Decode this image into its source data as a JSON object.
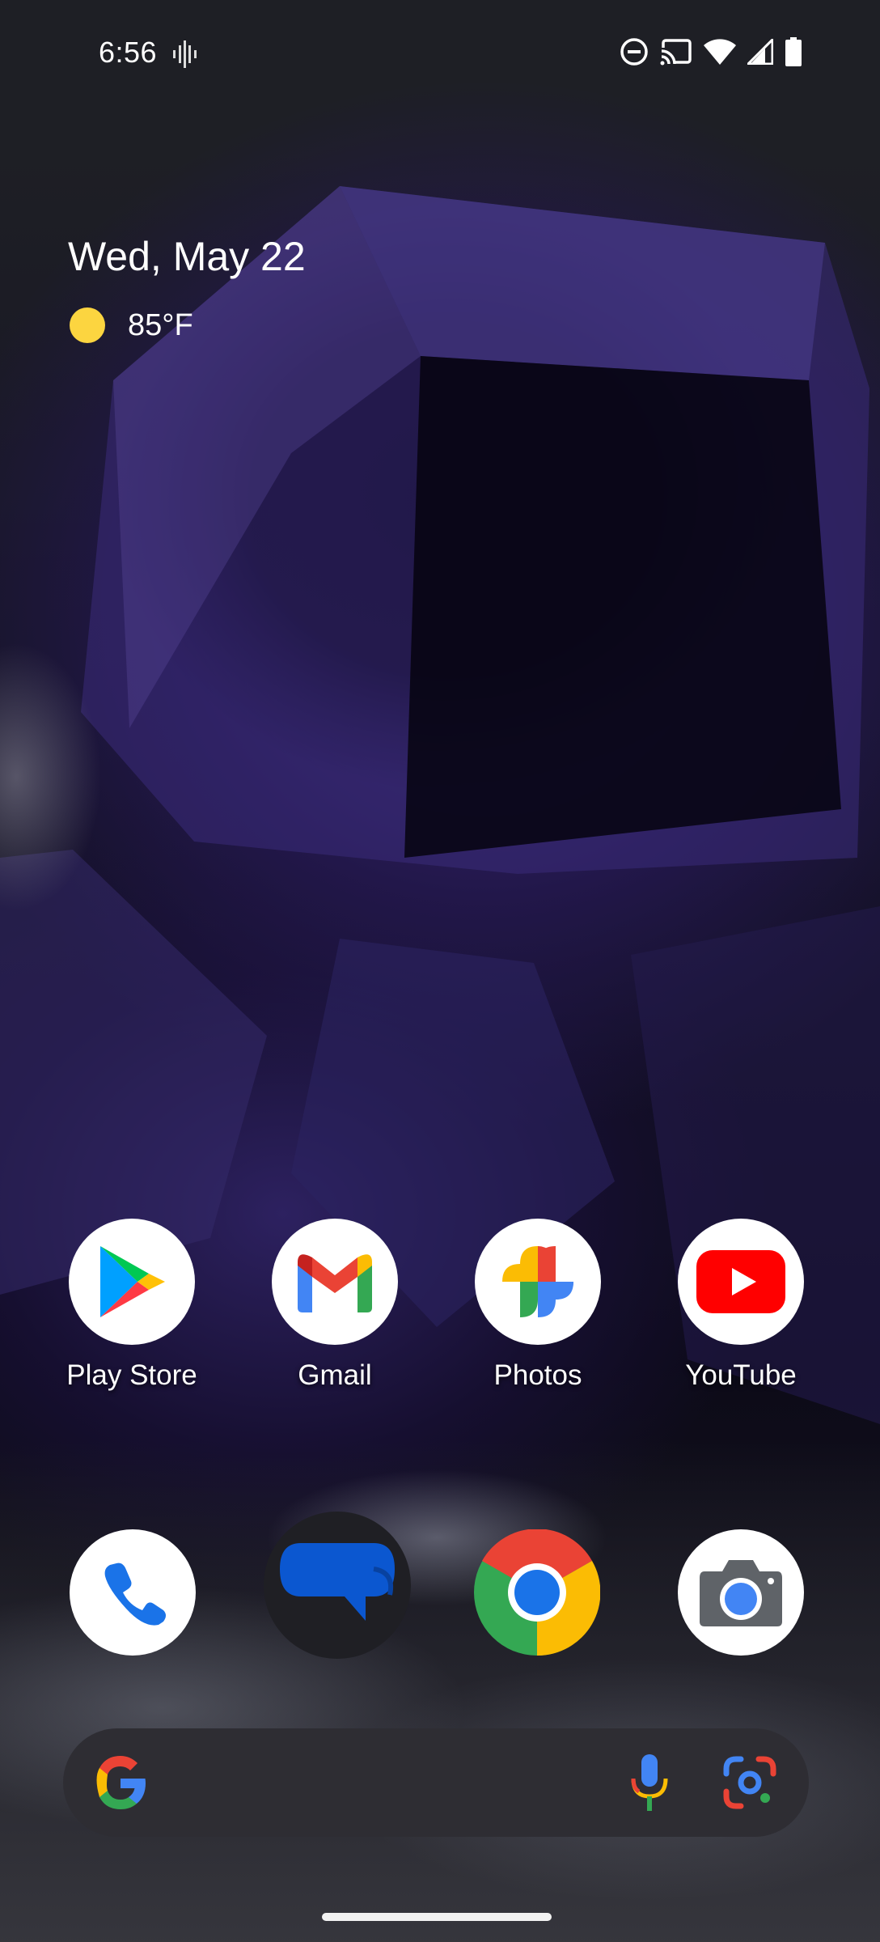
{
  "status_bar": {
    "time": "6:56",
    "icons": [
      "vibrate-icon",
      "do-not-disturb-icon",
      "cast-icon",
      "wifi-icon",
      "cell-signal-icon",
      "battery-icon"
    ]
  },
  "at_a_glance": {
    "date": "Wed, May 22",
    "weather_icon": "sun-icon",
    "temperature": "85°F"
  },
  "apps": [
    {
      "label": "Play Store",
      "icon": "play-store-icon"
    },
    {
      "label": "Gmail",
      "icon": "gmail-icon"
    },
    {
      "label": "Photos",
      "icon": "photos-icon"
    },
    {
      "label": "YouTube",
      "icon": "youtube-icon"
    }
  ],
  "dock": [
    {
      "icon": "phone-icon"
    },
    {
      "icon": "messages-icon"
    },
    {
      "icon": "chrome-icon"
    },
    {
      "icon": "camera-icon"
    }
  ],
  "search_bar": {
    "icons": [
      "google-g-icon",
      "microphone-icon",
      "google-lens-icon"
    ]
  },
  "colors": {
    "accent_blue": "#1a73e8",
    "google_red": "#ea4335",
    "google_yellow": "#fbbc04",
    "google_green": "#34a853",
    "youtube_red": "#ff0000",
    "search_bar_bg": "#2e2d33"
  }
}
